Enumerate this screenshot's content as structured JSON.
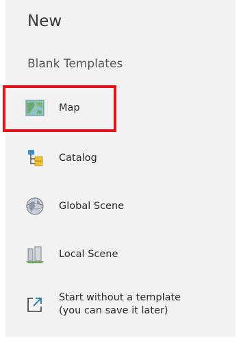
{
  "header": {
    "title": "New"
  },
  "section": {
    "label": "Blank Templates"
  },
  "items": [
    {
      "label": "Map",
      "icon": "map-icon"
    },
    {
      "label": "Catalog",
      "icon": "catalog-icon"
    },
    {
      "label": "Global Scene",
      "icon": "globe-icon"
    },
    {
      "label": "Local Scene",
      "icon": "local-scene-icon"
    },
    {
      "label": "Start without a template",
      "label2": "(you can save it later)",
      "icon": "open-external-icon"
    }
  ],
  "colors": {
    "highlight": "#e8141c",
    "panel": "#f2f2f2"
  }
}
